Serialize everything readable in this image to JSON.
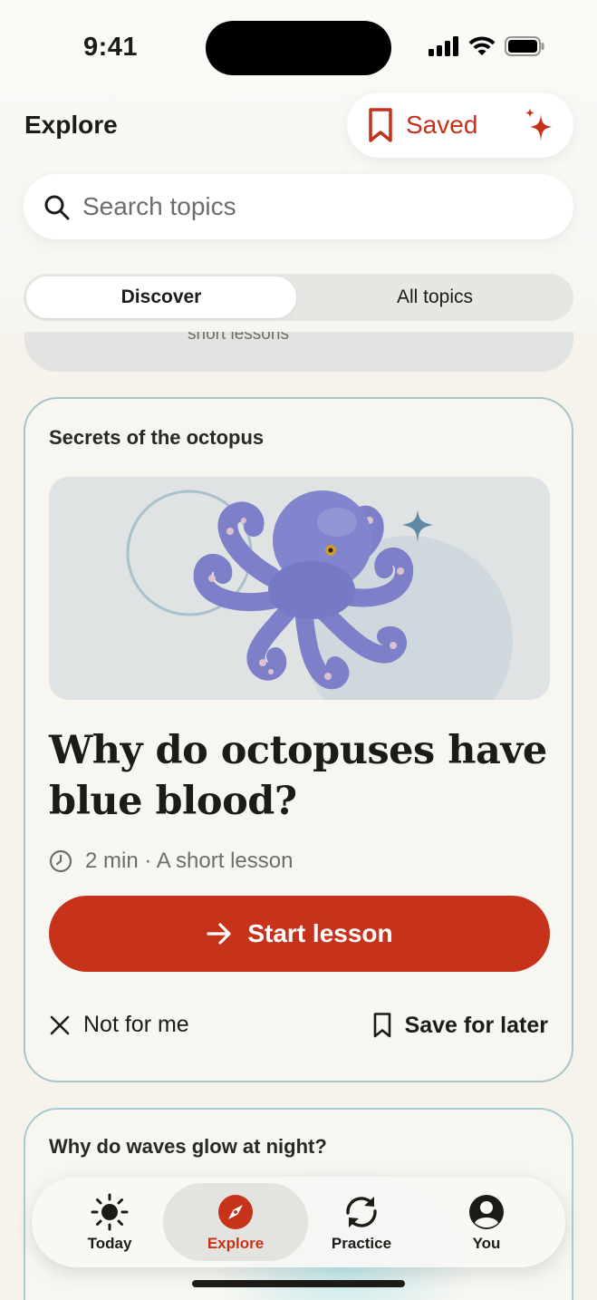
{
  "status_bar": {
    "time": "9:41"
  },
  "header": {
    "title": "Explore",
    "saved_label": "Saved",
    "search_placeholder": "Search topics",
    "segments": [
      {
        "label": "Discover",
        "active": true
      },
      {
        "label": "All topics",
        "active": false
      }
    ]
  },
  "previous_card": {
    "subtitle": "short lessons"
  },
  "lesson_card": {
    "kicker": "Secrets of the octopus",
    "title": "Why do octopuses have blue blood?",
    "meta": "2 min · A short lesson",
    "start_label": "Start lesson",
    "dismiss_label": "Not for me",
    "save_label": "Save for later"
  },
  "next_card": {
    "kicker": "Why do waves glow at night?"
  },
  "tab_bar": {
    "tabs": [
      {
        "label": "Today",
        "icon": "sun-icon",
        "active": false
      },
      {
        "label": "Explore",
        "icon": "compass-icon",
        "active": true
      },
      {
        "label": "Practice",
        "icon": "refresh-icon",
        "active": false
      },
      {
        "label": "You",
        "icon": "person-icon",
        "active": false
      }
    ]
  },
  "colors": {
    "accent": "#c7321b",
    "background": "#f6f3ec",
    "card_border": "#a9c3c8",
    "octopus": "#7c7fc9"
  }
}
